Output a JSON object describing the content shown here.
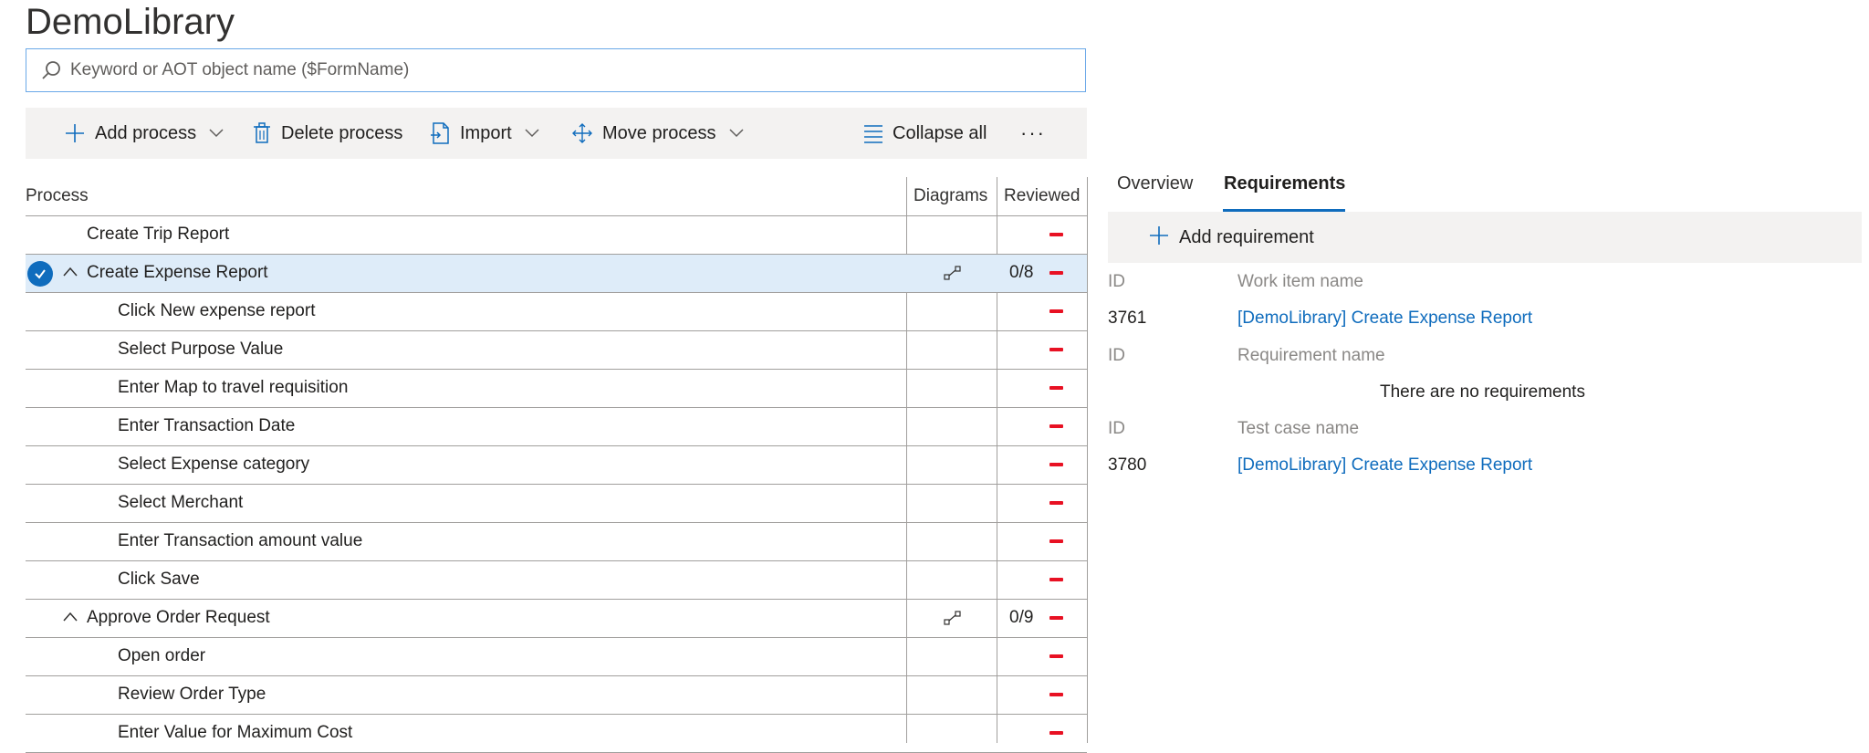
{
  "app": {
    "title": "DemoLibrary"
  },
  "search": {
    "placeholder": "Keyword or AOT object name ($FormName)"
  },
  "toolbar": {
    "add_process": "Add process",
    "delete_process": "Delete process",
    "import": "Import",
    "move_process": "Move process",
    "collapse_all": "Collapse all",
    "more": "···"
  },
  "table": {
    "headers": {
      "process": "Process",
      "diagrams": "Diagrams",
      "reviewed": "Reviewed"
    },
    "rows": [
      {
        "name": "Create Trip Report",
        "reviewed": ""
      },
      {
        "name": "Create Expense Report",
        "reviewed": "0/8"
      },
      {
        "name": "Click New expense report",
        "reviewed": ""
      },
      {
        "name": "Select Purpose Value",
        "reviewed": ""
      },
      {
        "name": "Enter Map to travel requisition",
        "reviewed": ""
      },
      {
        "name": "Enter Transaction Date",
        "reviewed": ""
      },
      {
        "name": "Select Expense category",
        "reviewed": ""
      },
      {
        "name": "Select Merchant",
        "reviewed": ""
      },
      {
        "name": "Enter Transaction amount value",
        "reviewed": ""
      },
      {
        "name": "Click Save",
        "reviewed": ""
      },
      {
        "name": "Approve Order Request",
        "reviewed": "0/9"
      },
      {
        "name": "Open order",
        "reviewed": ""
      },
      {
        "name": "Review Order Type",
        "reviewed": ""
      },
      {
        "name": "Enter Value for Maximum Cost",
        "reviewed": ""
      }
    ]
  },
  "panel": {
    "tabs": [
      "Overview",
      "Requirements"
    ],
    "active_tab": "Requirements",
    "add_requirement": "Add requirement",
    "work_item_header": {
      "id": "ID",
      "name": "Work item name"
    },
    "work_item": {
      "id": "3761",
      "name": "[DemoLibrary] Create Expense Report"
    },
    "requirement_header": {
      "id": "ID",
      "name": "Requirement name"
    },
    "no_requirements": "There are no requirements",
    "test_case_header": {
      "id": "ID",
      "name": "Test case name"
    },
    "test_case": {
      "id": "3780",
      "name": "[DemoLibrary] Create Expense Report"
    }
  },
  "colors": {
    "accent": "#0f6cbd",
    "status_red": "#e81123",
    "selected_row": "#deecf9"
  }
}
